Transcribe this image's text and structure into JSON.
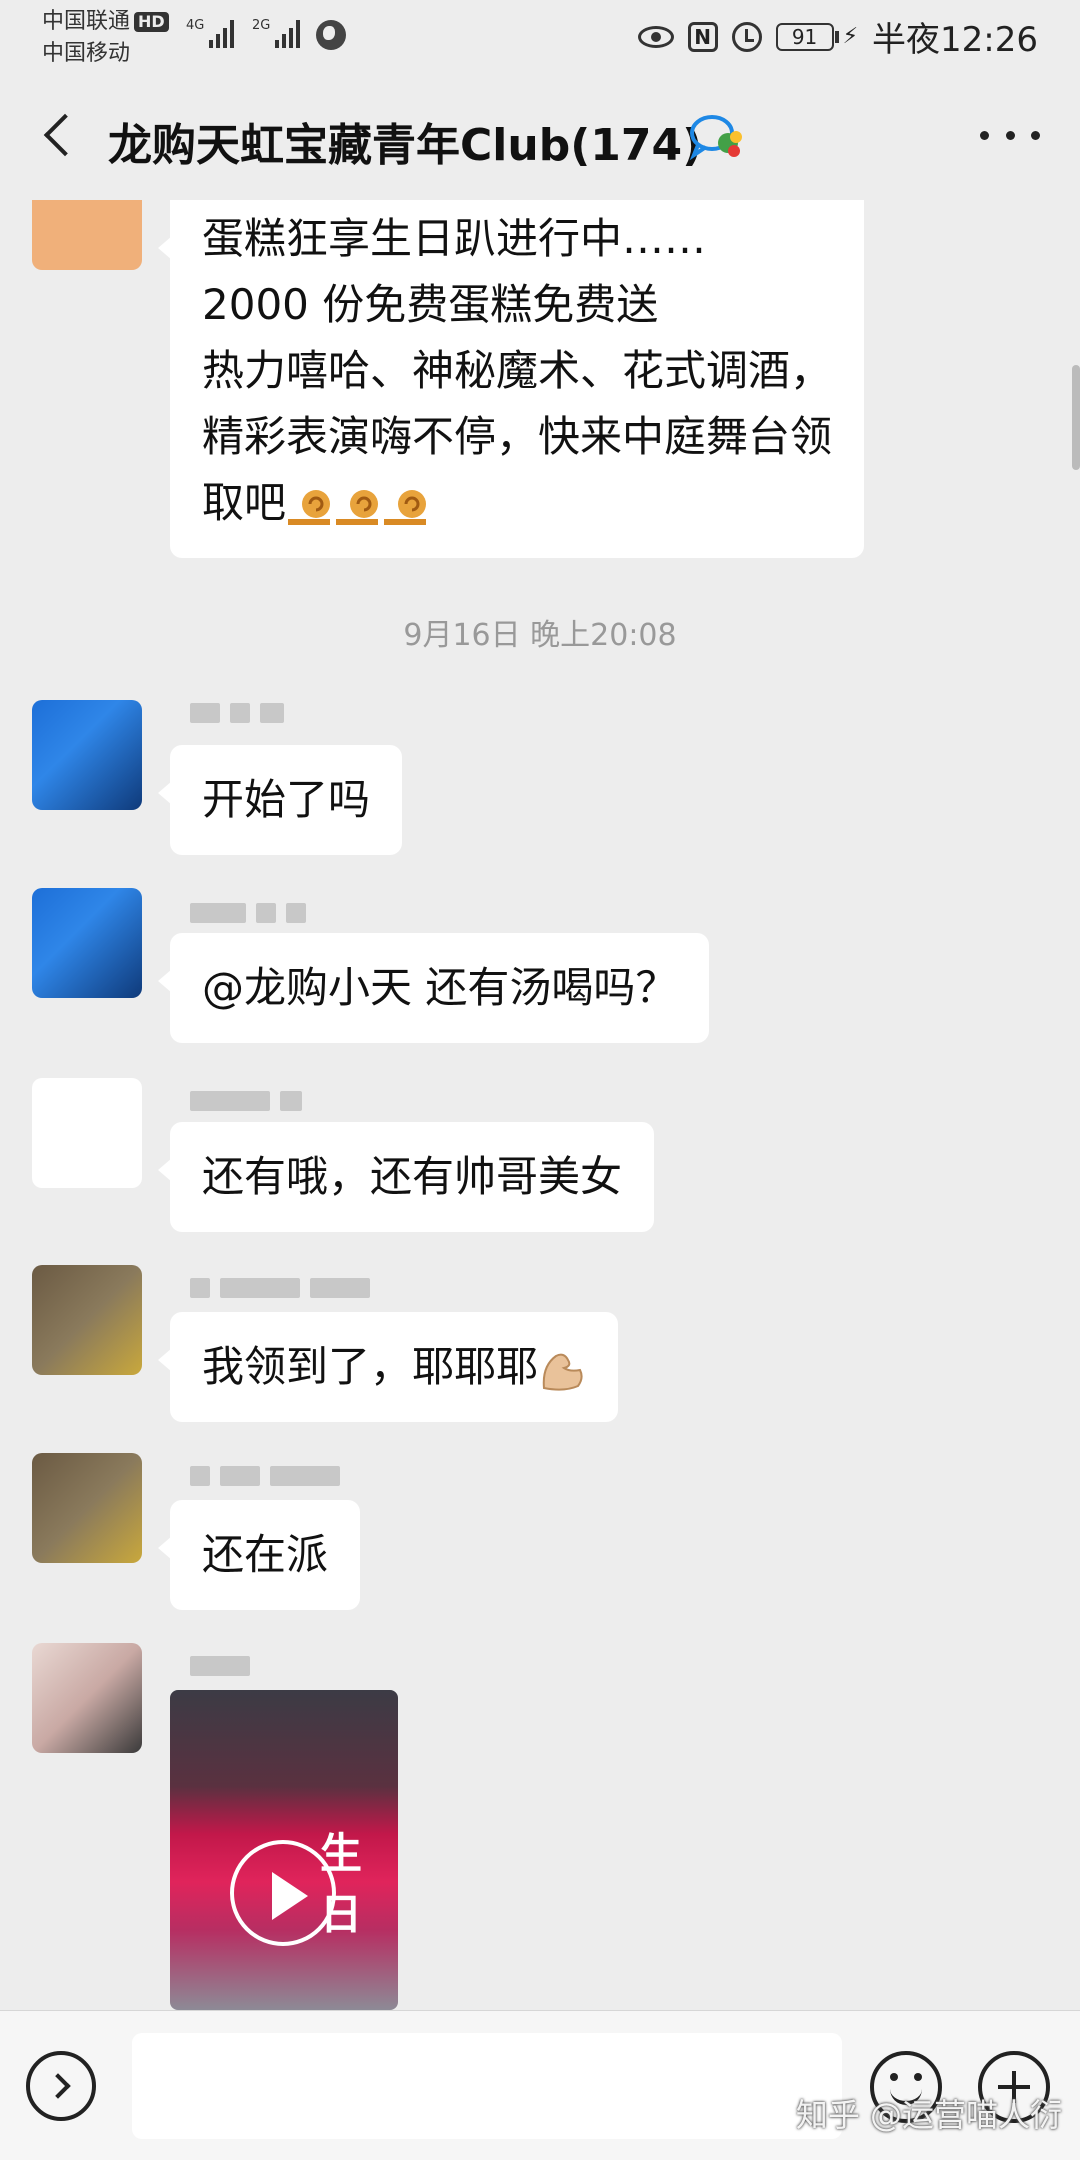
{
  "status_bar": {
    "carrier_1": "中国联通",
    "hd_badge": "HD",
    "carrier_2": "中国移动",
    "network_1": "4G",
    "network_2": "2G",
    "battery": "91",
    "time": "半夜12:26"
  },
  "header": {
    "title": "龙购天虹宝藏青年Club(174)",
    "back_icon": "chevron-left-icon",
    "group_icon": "chat-bubbles-icon",
    "more_icon": "more-icon"
  },
  "messages": [
    {
      "type": "text",
      "lines": [
        "蛋糕狂享生日趴进行中……",
        "2000 份免费蛋糕免费送",
        "热力嘻哈、神秘魔术、花式调酒，",
        "精彩表演嗨不停，快来中庭舞台领",
        "取吧"
      ],
      "emoji": "snail-emoji x3"
    },
    {
      "type": "timestamp",
      "text": "9月16日 晚上20:08"
    },
    {
      "type": "text",
      "text": "开始了吗"
    },
    {
      "type": "text",
      "text": "@龙购小天  还有汤喝吗？"
    },
    {
      "type": "text",
      "text": "还有哦，还有帅哥美女"
    },
    {
      "type": "text",
      "text": "我领到了，耶耶耶",
      "emoji": "flexed-bicep-emoji"
    },
    {
      "type": "text",
      "text": "还在派"
    },
    {
      "type": "video",
      "text": "生日",
      "icon": "play-icon"
    }
  ],
  "input_bar": {
    "voice_icon": "voice-icon",
    "emoji_icon": "emoji-icon",
    "plus_icon": "plus-icon"
  },
  "watermark": "知乎 @运营喵人衍",
  "colors": {
    "background": "#ededed",
    "bubble": "#ffffff",
    "timestamp": "#999999"
  }
}
